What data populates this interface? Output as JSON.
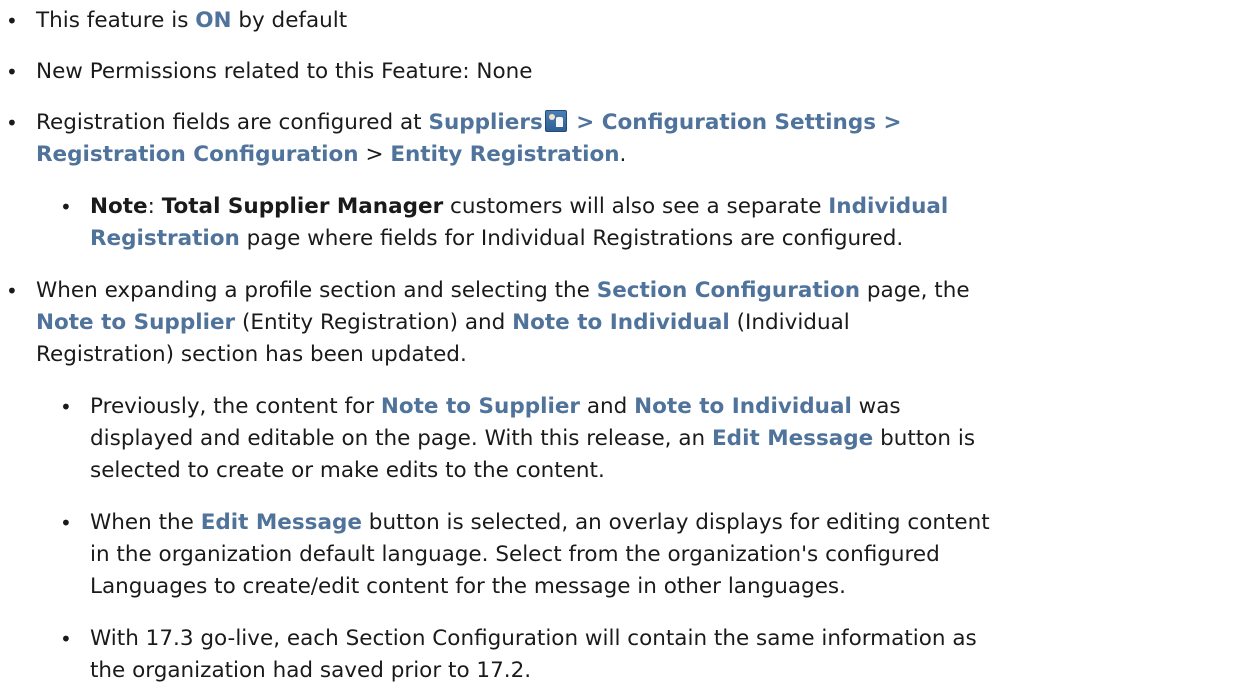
{
  "bullets": [
    {
      "parts": [
        {
          "t": "This feature is "
        },
        {
          "t": "ON",
          "s": "hl"
        },
        {
          "t": " by default"
        }
      ]
    },
    {
      "parts": [
        {
          "t": "New Permissions related to this Feature: None"
        }
      ]
    },
    {
      "line1": [
        {
          "t": "Registration fields are configured at "
        },
        {
          "t": "Suppliers",
          "s": "hl"
        },
        {
          "icon": "suppliers-icon"
        },
        {
          "t": " > Configuration Settings >",
          "s": "hl"
        }
      ],
      "line2": [
        {
          "t": "Registration Configuration",
          "s": "hl"
        },
        {
          "t": " > "
        },
        {
          "t": "Entity Registration",
          "s": "hl"
        },
        {
          "t": "."
        }
      ]
    }
  ],
  "sub_note": {
    "line1": [
      {
        "t": "Note",
        "s": "bold"
      },
      {
        "t": ": "
      },
      {
        "t": "Total Supplier Manager",
        "s": "bold"
      },
      {
        "t": " customers will also see a separate "
      },
      {
        "t": "Individual",
        "s": "hl"
      }
    ],
    "line2": [
      {
        "t": "Registration",
        "s": "hl"
      },
      {
        "t": " page where fields for Individual Registrations are configured."
      }
    ]
  },
  "bullet4": {
    "line1": [
      {
        "t": "When expanding a profile section and selecting the "
      },
      {
        "t": "Section Configuration",
        "s": "hl"
      },
      {
        "t": " page, the"
      }
    ],
    "line2": [
      {
        "t": "Note to Supplier",
        "s": "hl"
      },
      {
        "t": " (Entity Registration) and "
      },
      {
        "t": "Note to Individual",
        "s": "hl"
      },
      {
        "t": " (Individual"
      }
    ],
    "line3": [
      {
        "t": "Registration) section has been updated."
      }
    ]
  },
  "sub_items": [
    {
      "lines": [
        [
          {
            "t": "Previously, the content for "
          },
          {
            "t": "Note to Supplier",
            "s": "hl"
          },
          {
            "t": " and "
          },
          {
            "t": "Note to Individual",
            "s": "hl"
          },
          {
            "t": " was"
          }
        ],
        [
          {
            "t": "displayed and editable on the page. With this release, an "
          },
          {
            "t": "Edit Message",
            "s": "hl"
          },
          {
            "t": " button is"
          }
        ],
        [
          {
            "t": "selected to create or make edits to the content."
          }
        ]
      ]
    },
    {
      "lines": [
        [
          {
            "t": "When the "
          },
          {
            "t": "Edit Message",
            "s": "hl"
          },
          {
            "t": " button is selected, an overlay displays for editing content"
          }
        ],
        [
          {
            "t": "in the organization default language. Select from the organization's configured"
          }
        ],
        [
          {
            "t": "Languages to create/edit content for the message in other languages."
          }
        ]
      ]
    },
    {
      "lines": [
        [
          {
            "t": "With 17.3 go-live, each Section Configuration will contain the same information as"
          }
        ],
        [
          {
            "t": "the organization had saved prior to 17.2."
          }
        ]
      ]
    }
  ],
  "bullet_glyph": "•"
}
